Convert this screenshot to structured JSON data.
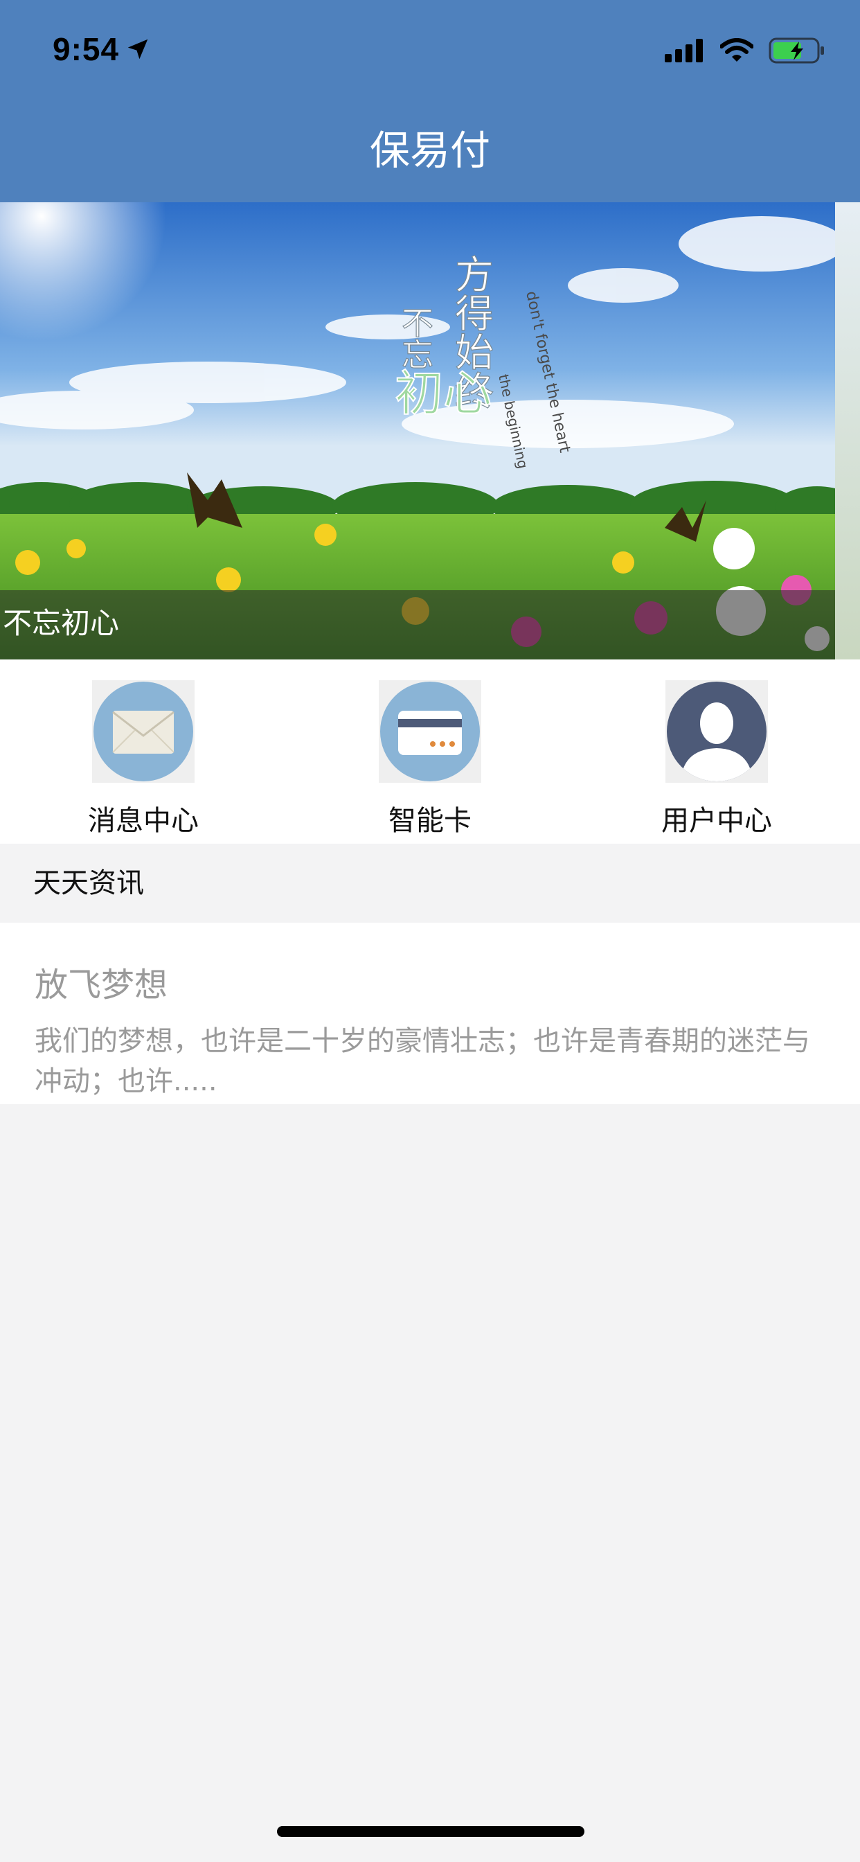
{
  "status": {
    "time": "9:54"
  },
  "header": {
    "title": "保易付"
  },
  "banner": {
    "caption": "不忘初心",
    "artwork_text": [
      "方得始终",
      "不忘",
      "初心",
      "don't forget the heart",
      "the beginning"
    ]
  },
  "menu": [
    {
      "label": "消息中心",
      "icon": "envelope-icon"
    },
    {
      "label": "智能卡",
      "icon": "card-icon"
    },
    {
      "label": "用户中心",
      "icon": "user-icon"
    }
  ],
  "section": {
    "title": "天天资讯"
  },
  "news": [
    {
      "title": "放飞梦想",
      "summary": "我们的梦想，也许是二十岁的豪情壮志；也许是青春期的迷茫与冲动；也许....."
    }
  ],
  "colors": {
    "header": "#4f81bd",
    "icon_blue": "#8ab4d6",
    "icon_dark": "#4d5a78"
  }
}
